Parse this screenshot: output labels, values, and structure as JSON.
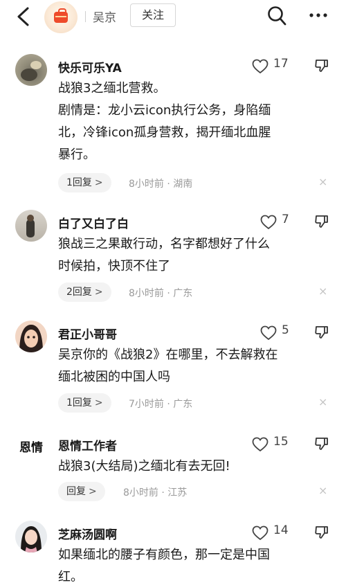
{
  "header": {
    "back_icon": "back-arrow-icon",
    "author": "吴京",
    "follow_label": "关注",
    "search_icon": "search-icon",
    "more_icon": "more-icon"
  },
  "comments": [
    {
      "user": "快乐可乐YA",
      "likes": "17",
      "lines": [
        "战狼3之缅北营救。",
        "剧情是：龙小云icon执行公务，身陷缅",
        "北，冷锋icon孤身营救，揭开缅北血腥",
        "暴行。"
      ],
      "replies": "1回复",
      "meta": "8小时前 · 湖南"
    },
    {
      "user": "白了又白了白",
      "likes": "7",
      "lines": [
        "狼战三之果敢行动，名字都想好了什么",
        "时候拍，快顶不住了"
      ],
      "replies": "2回复",
      "meta": "8小时前 · 广东"
    },
    {
      "user": "君正小哥哥",
      "likes": "5",
      "lines": [
        "吴京你的《战狼2》在哪里，不去解救在",
        "缅北被困的中国人吗"
      ],
      "replies": "1回复",
      "meta": "7小时前 · 广东"
    },
    {
      "user": "恩情工作者",
      "avatar_text": "恩情",
      "likes": "15",
      "lines": [
        "战狼3(大结局)之缅北有去无回!"
      ],
      "replies": "回复",
      "meta": "8小时前 · 江苏"
    },
    {
      "user": "芝麻汤圆啊",
      "likes": "14",
      "lines": [
        "如果缅北的腰子有颜色，那一定是中国",
        "红。"
      ]
    }
  ],
  "reply_chevron": ">",
  "close_glyph": "×",
  "colors": {
    "meta": "#9a9a9a",
    "pill_bg": "#f3f3f3",
    "brand_red": "#ee4b2b"
  }
}
